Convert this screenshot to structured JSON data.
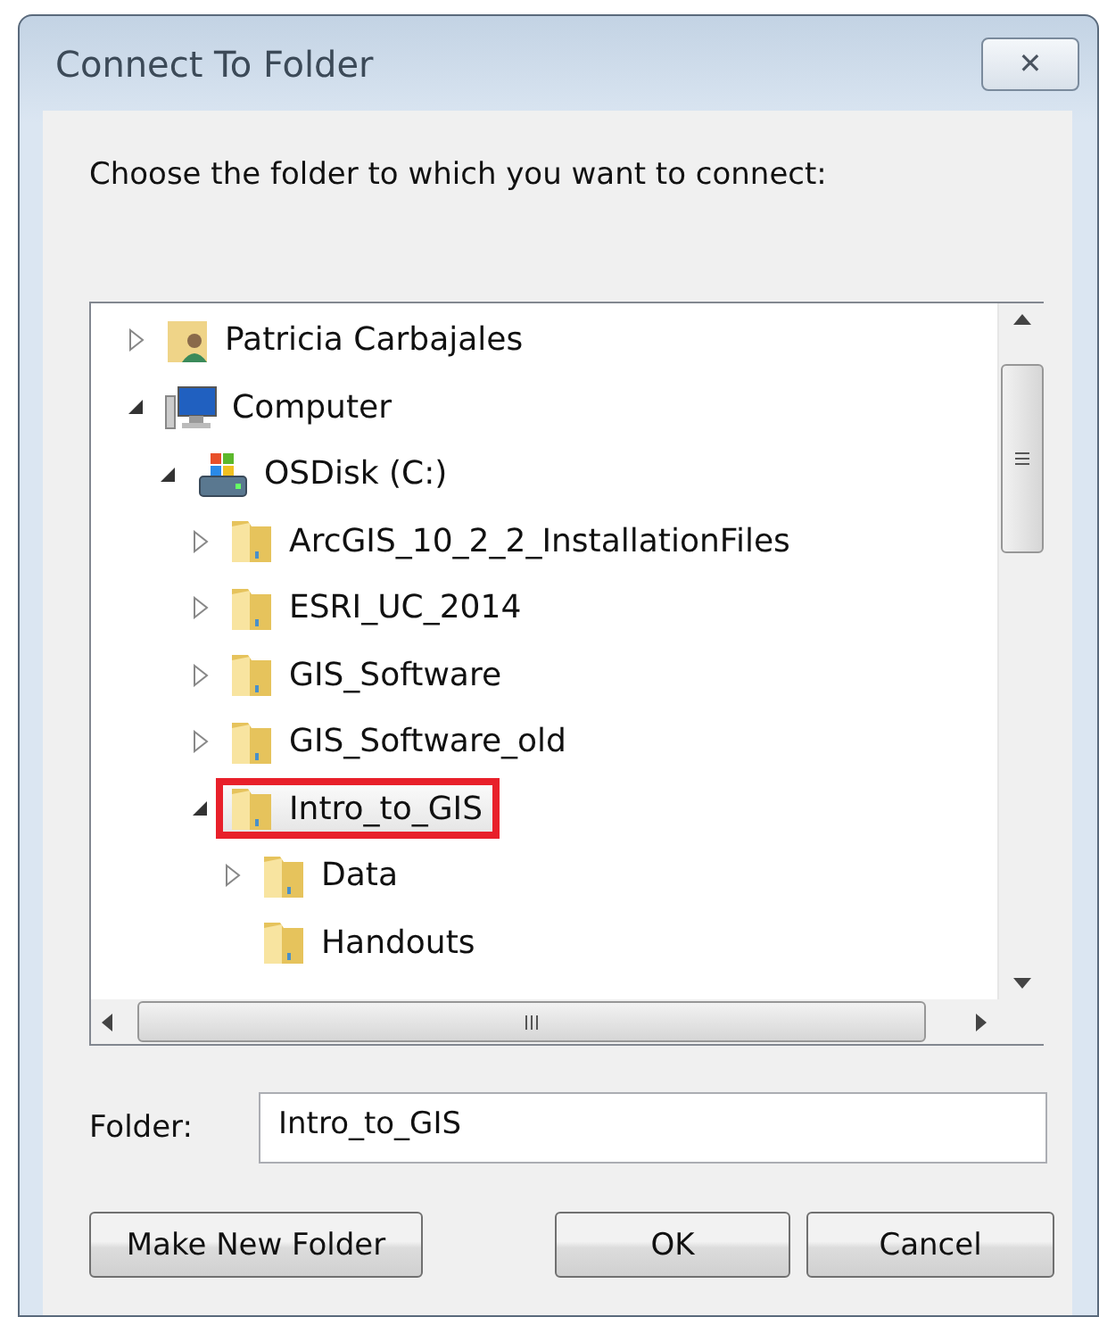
{
  "window": {
    "title": "Connect To Folder",
    "close_label": "✕"
  },
  "prompt": "Choose the folder to which you want to connect:",
  "tree": [
    {
      "label": "Patricia Carbajales",
      "kind": "user",
      "expanded": false,
      "selected": false
    },
    {
      "label": "Computer",
      "kind": "computer",
      "expanded": true,
      "selected": false,
      "children": [
        {
          "label": "OSDisk (C:)",
          "kind": "drive",
          "expanded": true,
          "selected": false,
          "children": [
            {
              "label": "ArcGIS_10_2_2_InstallationFiles",
              "kind": "folder",
              "expanded": false,
              "selected": false
            },
            {
              "label": "ESRI_UC_2014",
              "kind": "folder",
              "expanded": false,
              "selected": false
            },
            {
              "label": "GIS_Software",
              "kind": "folder",
              "expanded": false,
              "selected": false
            },
            {
              "label": "GIS_Software_old",
              "kind": "folder",
              "expanded": false,
              "selected": false
            },
            {
              "label": "Intro_to_GIS",
              "kind": "folder",
              "expanded": true,
              "selected": true,
              "children": [
                {
                  "label": "Data",
                  "kind": "folder",
                  "expanded": false,
                  "selected": false
                },
                {
                  "label": "Handouts",
                  "kind": "folder",
                  "selected": false
                }
              ]
            }
          ]
        }
      ]
    }
  ],
  "folder_field": {
    "label": "Folder:",
    "value": "Intro_to_GIS"
  },
  "buttons": [
    {
      "label": "Make New Folder"
    },
    {
      "label": "OK"
    },
    {
      "label": "Cancel"
    }
  ]
}
